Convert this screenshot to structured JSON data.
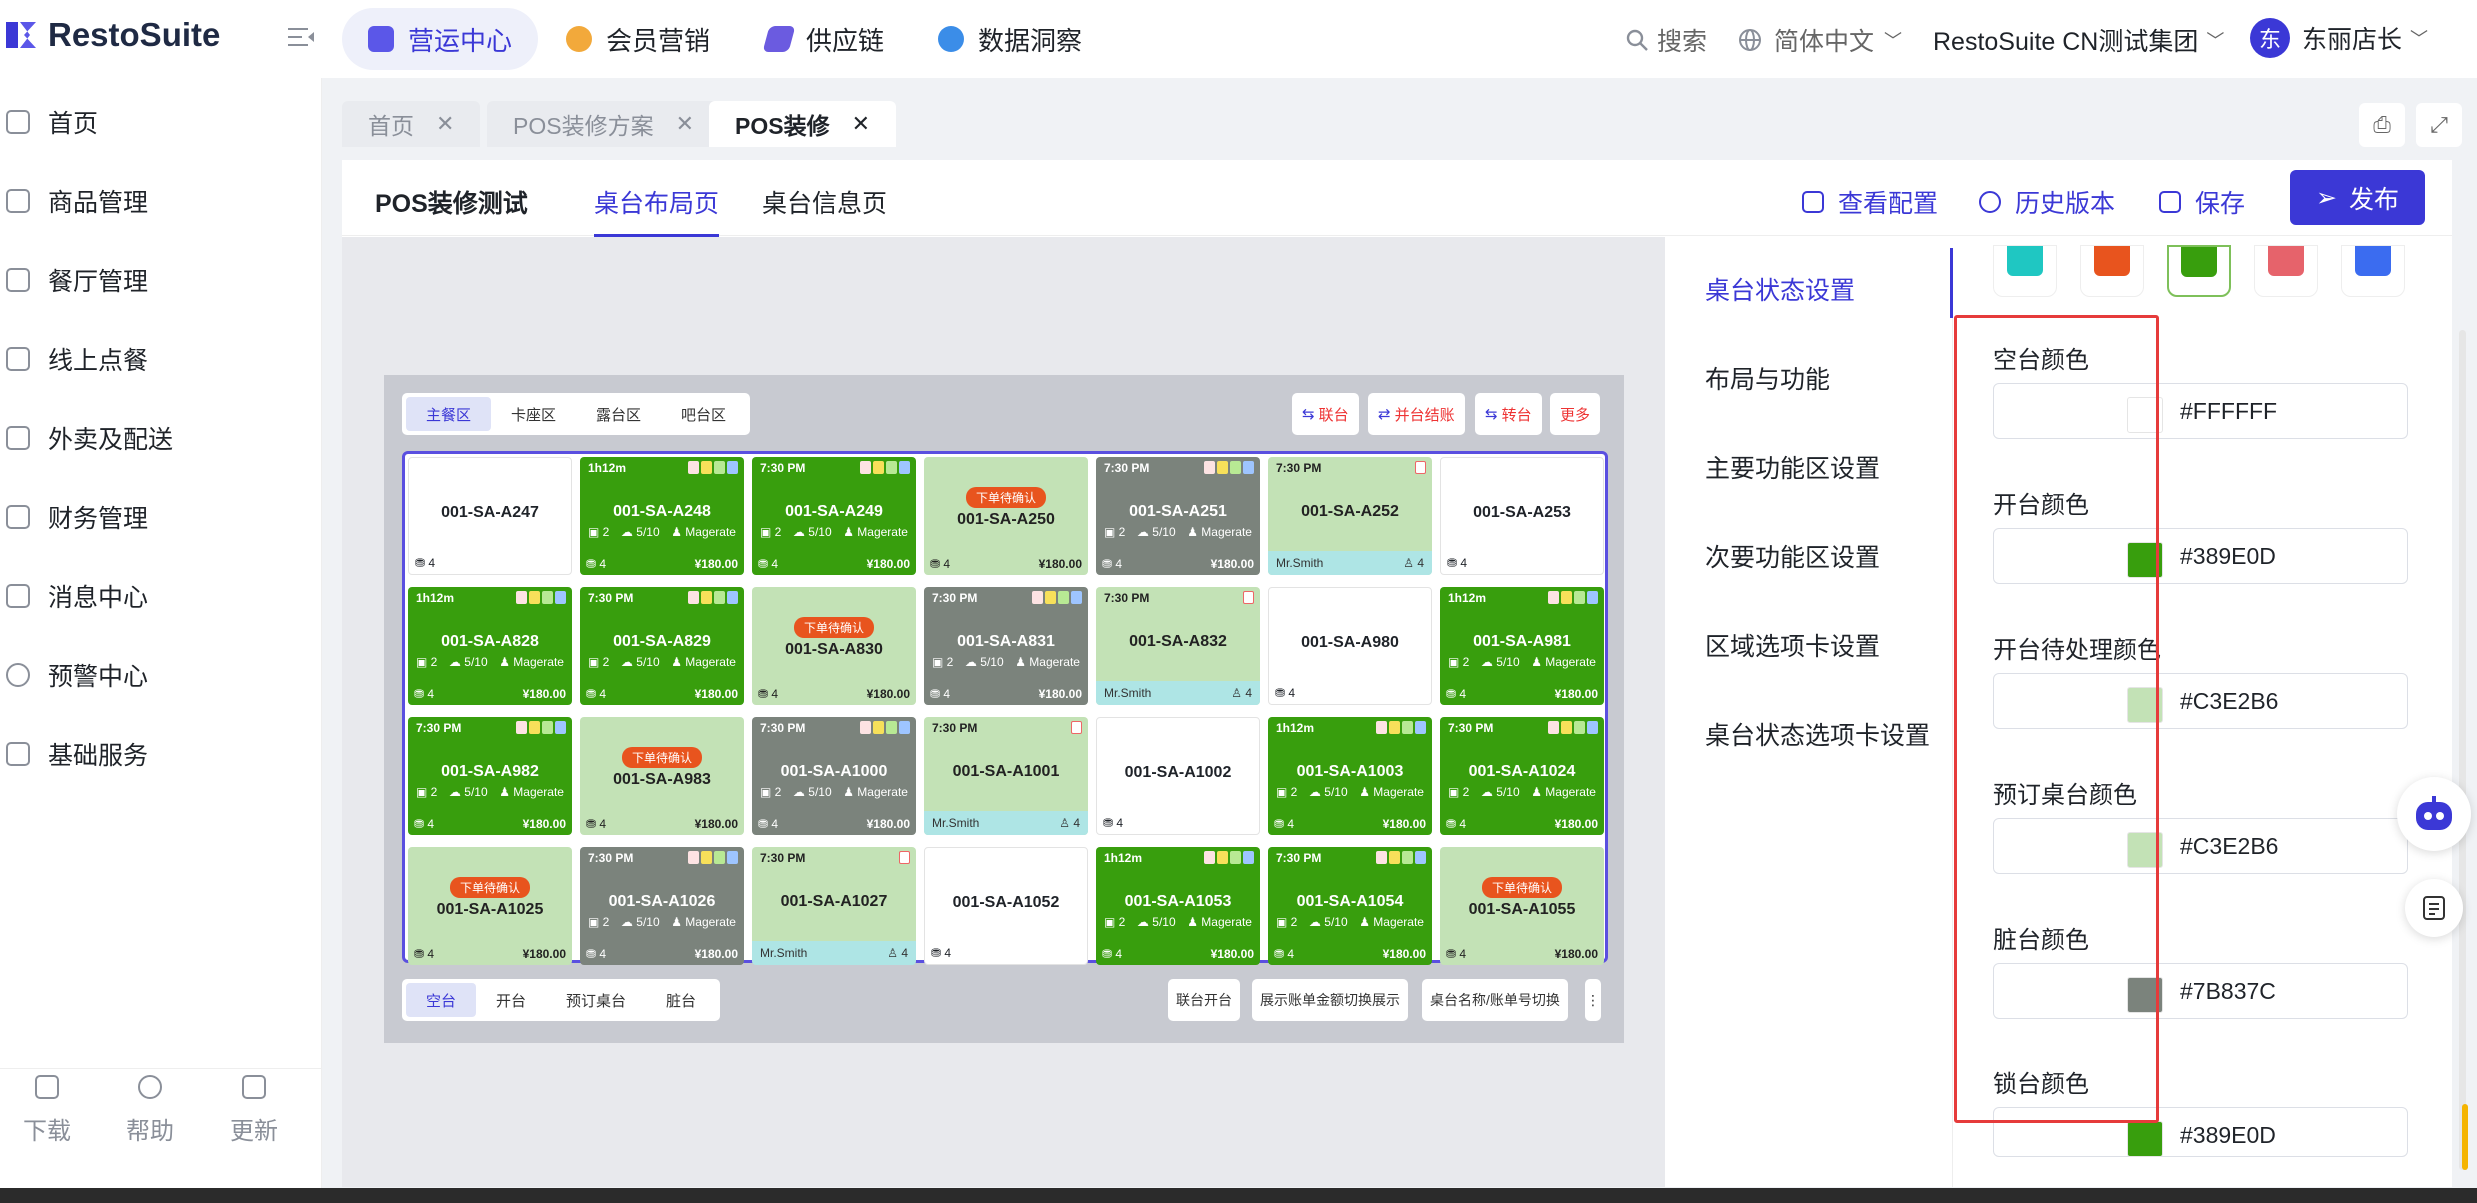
{
  "brand": {
    "name": "RestoSuite"
  },
  "topnav": {
    "tabs": [
      {
        "label": "营运中心",
        "color": "#5b57e8"
      },
      {
        "label": "会员营销",
        "color": "#f2a93b"
      },
      {
        "label": "供应链",
        "color": "#6b5be0"
      },
      {
        "label": "数据洞察",
        "color": "#3b8de8"
      }
    ],
    "search": "搜索",
    "language": "简体中文",
    "org": "RestoSuite CN测试集团",
    "avatar_initial": "东",
    "user": "东丽店长"
  },
  "sidebar": {
    "items": [
      {
        "label": "首页"
      },
      {
        "label": "商品管理"
      },
      {
        "label": "餐厅管理"
      },
      {
        "label": "线上点餐"
      },
      {
        "label": "外卖及配送"
      },
      {
        "label": "财务管理"
      },
      {
        "label": "消息中心"
      },
      {
        "label": "预警中心"
      },
      {
        "label": "基础服务"
      }
    ],
    "bottom": [
      {
        "label": "下载"
      },
      {
        "label": "帮助"
      },
      {
        "label": "更新"
      }
    ]
  },
  "pagetabs": [
    {
      "label": "首页",
      "close": "✕"
    },
    {
      "label": "POS装修方案",
      "close": "✕"
    },
    {
      "label": "POS装修",
      "close": "✕"
    }
  ],
  "panel": {
    "title": "POS装修测试",
    "tabs": [
      "桌台布局页",
      "桌台信息页"
    ],
    "actions": [
      "查看配置",
      "历史版本",
      "保存"
    ],
    "publish": "发布"
  },
  "preview": {
    "zones": [
      "主餐区",
      "卡座区",
      "露台区",
      "吧台区"
    ],
    "actions": [
      "联台",
      "并台结账",
      "转台",
      "更多"
    ],
    "status_tabs": [
      "空台",
      "开台",
      "预订桌台",
      "脏台"
    ],
    "bottom_actions": [
      "联台开台",
      "展示账单金额切换展示",
      "桌台名称/账单号切换",
      "⋮"
    ],
    "tables": [
      {
        "name": "001-SA-A247",
        "state": "empty",
        "seats": "4"
      },
      {
        "name": "001-SA-A248",
        "state": "open",
        "time": "1h12m",
        "guests": "2",
        "ratio": "5/10",
        "waiter": "Magerate",
        "seats": "4",
        "amount": "¥180.00"
      },
      {
        "name": "001-SA-A249",
        "state": "open",
        "time": "7:30 PM",
        "guests": "2",
        "ratio": "5/10",
        "waiter": "Magerate",
        "seats": "4",
        "amount": "¥180.00"
      },
      {
        "name": "001-SA-A250",
        "state": "pend",
        "badge": "下单待确认",
        "seats": "4",
        "amount": "¥180.00"
      },
      {
        "name": "001-SA-A251",
        "state": "dirty",
        "time": "7:30 PM",
        "guests": "2",
        "ratio": "5/10",
        "waiter": "Magerate",
        "seats": "4",
        "amount": "¥180.00"
      },
      {
        "name": "001-SA-A252",
        "state": "resv",
        "time": "7:30 PM",
        "reserver": "Mr.Smith",
        "seats": "4"
      },
      {
        "name": "001-SA-A253",
        "state": "empty",
        "seats": "4"
      },
      {
        "name": "001-SA-A828",
        "state": "open",
        "time": "1h12m",
        "guests": "2",
        "ratio": "5/10",
        "waiter": "Magerate",
        "seats": "4",
        "amount": "¥180.00"
      },
      {
        "name": "001-SA-A829",
        "state": "open",
        "time": "7:30 PM",
        "guests": "2",
        "ratio": "5/10",
        "waiter": "Magerate",
        "seats": "4",
        "amount": "¥180.00"
      },
      {
        "name": "001-SA-A830",
        "state": "pend",
        "badge": "下单待确认",
        "seats": "4",
        "amount": "¥180.00"
      },
      {
        "name": "001-SA-A831",
        "state": "dirty",
        "time": "7:30 PM",
        "guests": "2",
        "ratio": "5/10",
        "waiter": "Magerate",
        "seats": "4",
        "amount": "¥180.00"
      },
      {
        "name": "001-SA-A832",
        "state": "resv",
        "time": "7:30 PM",
        "reserver": "Mr.Smith",
        "seats": "4"
      },
      {
        "name": "001-SA-A980",
        "state": "empty",
        "seats": "4"
      },
      {
        "name": "001-SA-A981",
        "state": "open",
        "time": "1h12m",
        "guests": "2",
        "ratio": "5/10",
        "waiter": "Magerate",
        "seats": "4",
        "amount": "¥180.00"
      },
      {
        "name": "001-SA-A982",
        "state": "open",
        "time": "7:30 PM",
        "guests": "2",
        "ratio": "5/10",
        "waiter": "Magerate",
        "seats": "4",
        "amount": "¥180.00"
      },
      {
        "name": "001-SA-A983",
        "state": "pend",
        "badge": "下单待确认",
        "seats": "4",
        "amount": "¥180.00"
      },
      {
        "name": "001-SA-A1000",
        "state": "dirty",
        "time": "7:30 PM",
        "guests": "2",
        "ratio": "5/10",
        "waiter": "Magerate",
        "seats": "4",
        "amount": "¥180.00"
      },
      {
        "name": "001-SA-A1001",
        "state": "resv",
        "time": "7:30 PM",
        "reserver": "Mr.Smith",
        "seats": "4"
      },
      {
        "name": "001-SA-A1002",
        "state": "empty",
        "seats": "4"
      },
      {
        "name": "001-SA-A1003",
        "state": "open",
        "time": "1h12m",
        "guests": "2",
        "ratio": "5/10",
        "waiter": "Magerate",
        "seats": "4",
        "amount": "¥180.00"
      },
      {
        "name": "001-SA-A1024",
        "state": "open",
        "time": "7:30 PM",
        "guests": "2",
        "ratio": "5/10",
        "waiter": "Magerate",
        "seats": "4",
        "amount": "¥180.00"
      },
      {
        "name": "001-SA-A1025",
        "state": "pend",
        "badge": "下单待确认",
        "seats": "4",
        "amount": "¥180.00"
      },
      {
        "name": "001-SA-A1026",
        "state": "dirty",
        "time": "7:30 PM",
        "guests": "2",
        "ratio": "5/10",
        "waiter": "Magerate",
        "seats": "4",
        "amount": "¥180.00"
      },
      {
        "name": "001-SA-A1027",
        "state": "resv",
        "time": "7:30 PM",
        "reserver": "Mr.Smith",
        "seats": "4"
      },
      {
        "name": "001-SA-A1052",
        "state": "empty",
        "seats": "4"
      },
      {
        "name": "001-SA-A1053",
        "state": "open",
        "time": "1h12m",
        "guests": "2",
        "ratio": "5/10",
        "waiter": "Magerate",
        "seats": "4",
        "amount": "¥180.00"
      },
      {
        "name": "001-SA-A1054",
        "state": "open",
        "time": "7:30 PM",
        "guests": "2",
        "ratio": "5/10",
        "waiter": "Magerate",
        "seats": "4",
        "amount": "¥180.00"
      },
      {
        "name": "001-SA-A1055",
        "state": "pend",
        "badge": "下单待确认",
        "seats": "4",
        "amount": "¥180.00"
      }
    ]
  },
  "settings_nav": [
    "桌台状态设置",
    "布局与功能",
    "主要功能区设置",
    "次要功能区设置",
    "区域选项卡设置",
    "桌台状态选项卡设置"
  ],
  "swatches": [
    "#1fc7c2",
    "#e8541e",
    "#389E0D",
    "#e6636b",
    "#3b6cf0"
  ],
  "color_fields": [
    {
      "label": "空台颜色",
      "hex": "#FFFFFF"
    },
    {
      "label": "开台颜色",
      "hex": "#389E0D"
    },
    {
      "label": "开台待处理颜色",
      "hex": "#C3E2B6"
    },
    {
      "label": "预订桌台颜色",
      "hex": "#C3E2B6"
    },
    {
      "label": "脏台颜色",
      "hex": "#7B837C"
    },
    {
      "label": "锁台颜色",
      "hex": "#389E0D"
    }
  ]
}
